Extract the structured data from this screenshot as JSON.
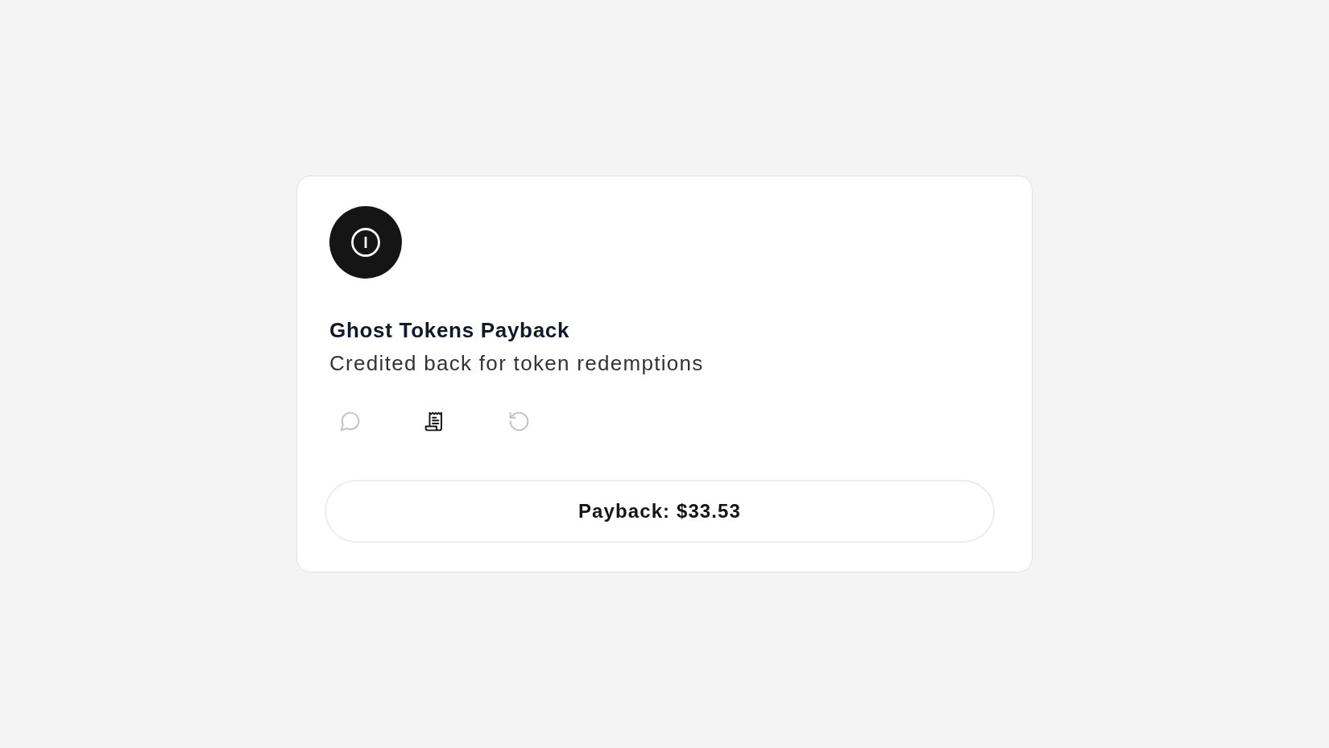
{
  "card": {
    "title": "Ghost Tokens Payback",
    "subtitle": "Credited back for token redemptions",
    "actions": [
      {
        "kind": "comment",
        "selected": false
      },
      {
        "kind": "receipt",
        "selected": true
      },
      {
        "kind": "history",
        "selected": false
      }
    ],
    "payback_button": {
      "label": "Payback: $33.53"
    }
  }
}
